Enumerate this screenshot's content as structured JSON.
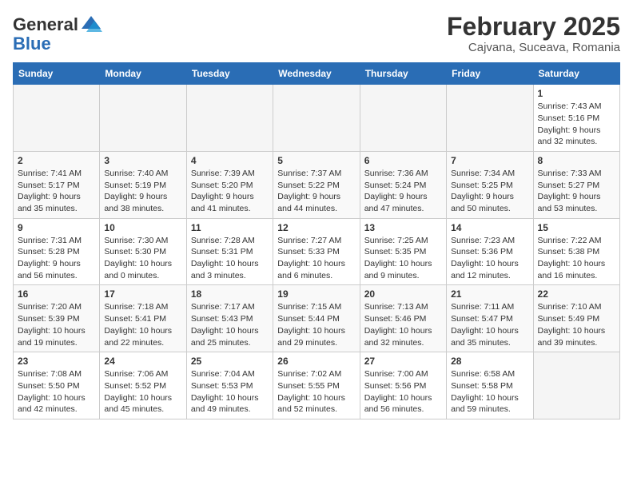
{
  "header": {
    "logo_general": "General",
    "logo_blue": "Blue",
    "month": "February 2025",
    "location": "Cajvana, Suceava, Romania"
  },
  "weekdays": [
    "Sunday",
    "Monday",
    "Tuesday",
    "Wednesday",
    "Thursday",
    "Friday",
    "Saturday"
  ],
  "weeks": [
    [
      {
        "day": "",
        "info": ""
      },
      {
        "day": "",
        "info": ""
      },
      {
        "day": "",
        "info": ""
      },
      {
        "day": "",
        "info": ""
      },
      {
        "day": "",
        "info": ""
      },
      {
        "day": "",
        "info": ""
      },
      {
        "day": "1",
        "info": "Sunrise: 7:43 AM\nSunset: 5:16 PM\nDaylight: 9 hours and 32 minutes."
      }
    ],
    [
      {
        "day": "2",
        "info": "Sunrise: 7:41 AM\nSunset: 5:17 PM\nDaylight: 9 hours and 35 minutes."
      },
      {
        "day": "3",
        "info": "Sunrise: 7:40 AM\nSunset: 5:19 PM\nDaylight: 9 hours and 38 minutes."
      },
      {
        "day": "4",
        "info": "Sunrise: 7:39 AM\nSunset: 5:20 PM\nDaylight: 9 hours and 41 minutes."
      },
      {
        "day": "5",
        "info": "Sunrise: 7:37 AM\nSunset: 5:22 PM\nDaylight: 9 hours and 44 minutes."
      },
      {
        "day": "6",
        "info": "Sunrise: 7:36 AM\nSunset: 5:24 PM\nDaylight: 9 hours and 47 minutes."
      },
      {
        "day": "7",
        "info": "Sunrise: 7:34 AM\nSunset: 5:25 PM\nDaylight: 9 hours and 50 minutes."
      },
      {
        "day": "8",
        "info": "Sunrise: 7:33 AM\nSunset: 5:27 PM\nDaylight: 9 hours and 53 minutes."
      }
    ],
    [
      {
        "day": "9",
        "info": "Sunrise: 7:31 AM\nSunset: 5:28 PM\nDaylight: 9 hours and 56 minutes."
      },
      {
        "day": "10",
        "info": "Sunrise: 7:30 AM\nSunset: 5:30 PM\nDaylight: 10 hours and 0 minutes."
      },
      {
        "day": "11",
        "info": "Sunrise: 7:28 AM\nSunset: 5:31 PM\nDaylight: 10 hours and 3 minutes."
      },
      {
        "day": "12",
        "info": "Sunrise: 7:27 AM\nSunset: 5:33 PM\nDaylight: 10 hours and 6 minutes."
      },
      {
        "day": "13",
        "info": "Sunrise: 7:25 AM\nSunset: 5:35 PM\nDaylight: 10 hours and 9 minutes."
      },
      {
        "day": "14",
        "info": "Sunrise: 7:23 AM\nSunset: 5:36 PM\nDaylight: 10 hours and 12 minutes."
      },
      {
        "day": "15",
        "info": "Sunrise: 7:22 AM\nSunset: 5:38 PM\nDaylight: 10 hours and 16 minutes."
      }
    ],
    [
      {
        "day": "16",
        "info": "Sunrise: 7:20 AM\nSunset: 5:39 PM\nDaylight: 10 hours and 19 minutes."
      },
      {
        "day": "17",
        "info": "Sunrise: 7:18 AM\nSunset: 5:41 PM\nDaylight: 10 hours and 22 minutes."
      },
      {
        "day": "18",
        "info": "Sunrise: 7:17 AM\nSunset: 5:43 PM\nDaylight: 10 hours and 25 minutes."
      },
      {
        "day": "19",
        "info": "Sunrise: 7:15 AM\nSunset: 5:44 PM\nDaylight: 10 hours and 29 minutes."
      },
      {
        "day": "20",
        "info": "Sunrise: 7:13 AM\nSunset: 5:46 PM\nDaylight: 10 hours and 32 minutes."
      },
      {
        "day": "21",
        "info": "Sunrise: 7:11 AM\nSunset: 5:47 PM\nDaylight: 10 hours and 35 minutes."
      },
      {
        "day": "22",
        "info": "Sunrise: 7:10 AM\nSunset: 5:49 PM\nDaylight: 10 hours and 39 minutes."
      }
    ],
    [
      {
        "day": "23",
        "info": "Sunrise: 7:08 AM\nSunset: 5:50 PM\nDaylight: 10 hours and 42 minutes."
      },
      {
        "day": "24",
        "info": "Sunrise: 7:06 AM\nSunset: 5:52 PM\nDaylight: 10 hours and 45 minutes."
      },
      {
        "day": "25",
        "info": "Sunrise: 7:04 AM\nSunset: 5:53 PM\nDaylight: 10 hours and 49 minutes."
      },
      {
        "day": "26",
        "info": "Sunrise: 7:02 AM\nSunset: 5:55 PM\nDaylight: 10 hours and 52 minutes."
      },
      {
        "day": "27",
        "info": "Sunrise: 7:00 AM\nSunset: 5:56 PM\nDaylight: 10 hours and 56 minutes."
      },
      {
        "day": "28",
        "info": "Sunrise: 6:58 AM\nSunset: 5:58 PM\nDaylight: 10 hours and 59 minutes."
      },
      {
        "day": "",
        "info": ""
      }
    ]
  ]
}
